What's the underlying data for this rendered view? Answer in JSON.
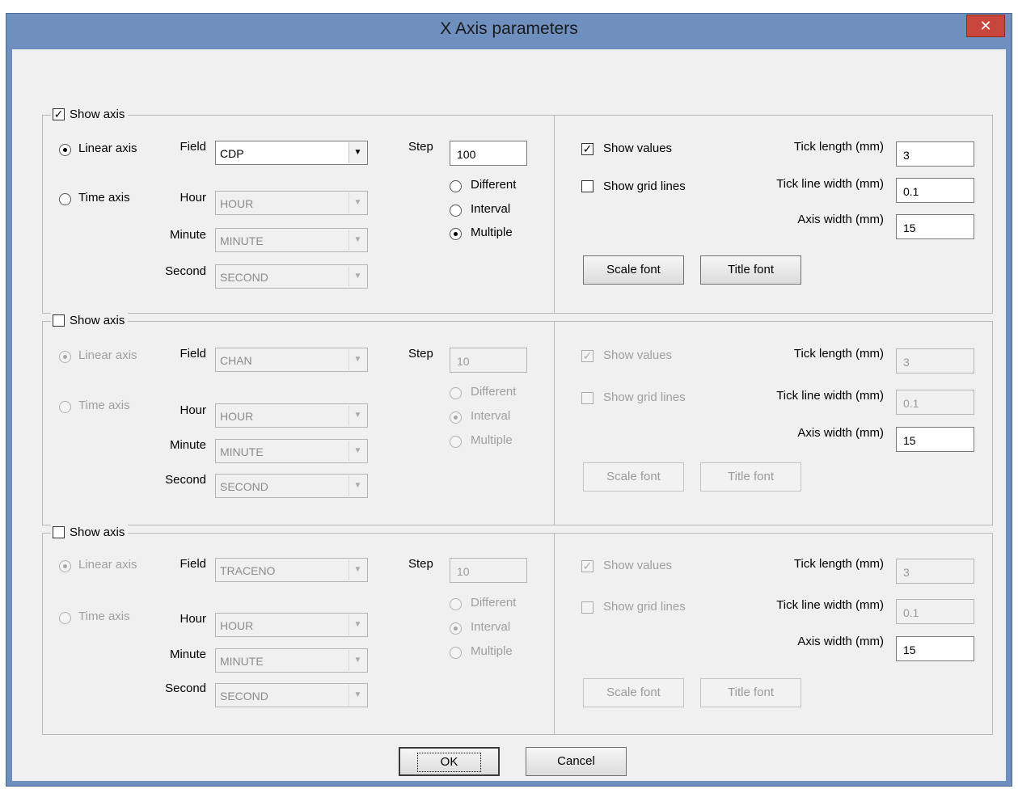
{
  "window": {
    "title": "X Axis parameters",
    "close_glyph": "✕"
  },
  "sections": [
    {
      "show_axis": {
        "label": "Show axis",
        "checked": true
      },
      "linear_label": "Linear axis",
      "time_label": "Time axis",
      "field_label": "Field",
      "field_value": "CDP",
      "hour_label": "Hour",
      "hour_value": "HOUR",
      "minute_label": "Minute",
      "minute_value": "MINUTE",
      "second_label": "Second",
      "second_value": "SECOND",
      "step_label": "Step",
      "step_value": "100",
      "different_label": "Different",
      "interval_label": "Interval",
      "multiple_label": "Multiple",
      "show_values": "Show values",
      "show_grid_lines": "Show grid lines",
      "tick_length_label": "Tick length (mm)",
      "tick_length_value": "3",
      "tick_line_width_label": "Tick line width (mm)",
      "tick_line_width_value": "0.1",
      "axis_width_label": "Axis width (mm)",
      "axis_width_value": "15",
      "scale_font": "Scale font",
      "title_font": "Title font"
    },
    {
      "show_axis": {
        "label": "Show axis",
        "checked": false
      },
      "linear_label": "Linear axis",
      "time_label": "Time axis",
      "field_label": "Field",
      "field_value": "CHAN",
      "hour_label": "Hour",
      "hour_value": "HOUR",
      "minute_label": "Minute",
      "minute_value": "MINUTE",
      "second_label": "Second",
      "second_value": "SECOND",
      "step_label": "Step",
      "step_value": "10",
      "different_label": "Different",
      "interval_label": "Interval",
      "multiple_label": "Multiple",
      "show_values": "Show values",
      "show_grid_lines": "Show grid lines",
      "tick_length_label": "Tick length (mm)",
      "tick_length_value": "3",
      "tick_line_width_label": "Tick line width (mm)",
      "tick_line_width_value": "0.1",
      "axis_width_label": "Axis width (mm)",
      "axis_width_value": "15",
      "scale_font": "Scale font",
      "title_font": "Title font"
    },
    {
      "show_axis": {
        "label": "Show axis",
        "checked": false
      },
      "linear_label": "Linear axis",
      "time_label": "Time axis",
      "field_label": "Field",
      "field_value": "TRACENO",
      "hour_label": "Hour",
      "hour_value": "HOUR",
      "minute_label": "Minute",
      "minute_value": "MINUTE",
      "second_label": "Second",
      "second_value": "SECOND",
      "step_label": "Step",
      "step_value": "10",
      "different_label": "Different",
      "interval_label": "Interval",
      "multiple_label": "Multiple",
      "show_values": "Show values",
      "show_grid_lines": "Show grid lines",
      "tick_length_label": "Tick length (mm)",
      "tick_length_value": "3",
      "tick_line_width_label": "Tick line width (mm)",
      "tick_line_width_value": "0.1",
      "axis_width_label": "Axis width (mm)",
      "axis_width_value": "15",
      "scale_font": "Scale font",
      "title_font": "Title font"
    }
  ],
  "buttons": {
    "ok": "OK",
    "cancel": "Cancel"
  },
  "check_glyph": "✓",
  "dropdown_glyph": "▼"
}
